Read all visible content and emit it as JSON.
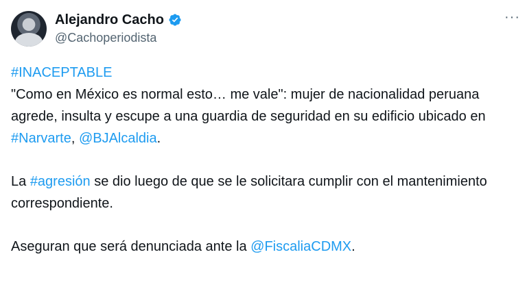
{
  "author": {
    "display_name": "Alejandro Cacho",
    "handle": "@Cachoperiodista"
  },
  "menu": {
    "more_label": "···"
  },
  "colors": {
    "link": "#1d9bf0",
    "verified": "#1d9bf0",
    "secondary_text": "#536471"
  },
  "icons": {
    "verified": "verified-badge-icon",
    "more": "more-options-icon"
  },
  "tweet": {
    "hashtag_line": "#INACEPTABLE",
    "p1": {
      "text1": "\"Como en México es normal esto… me vale\": mujer de nacionalidad peruana agrede, insulta y escupe a una guardia de seguridad en su edificio ubicado en ",
      "link1": "#Narvarte",
      "text2": ", ",
      "link2": "@BJAlcaldia",
      "text3": "."
    },
    "p2": {
      "text1": "La ",
      "link1": "#agresión",
      "text2": " se dio luego de que se le solicitara cumplir con el mantenimiento correspondiente."
    },
    "p3": {
      "text1": "Aseguran que será denunciada ante la ",
      "link1": "@FiscaliaCDMX",
      "text2": "."
    }
  }
}
